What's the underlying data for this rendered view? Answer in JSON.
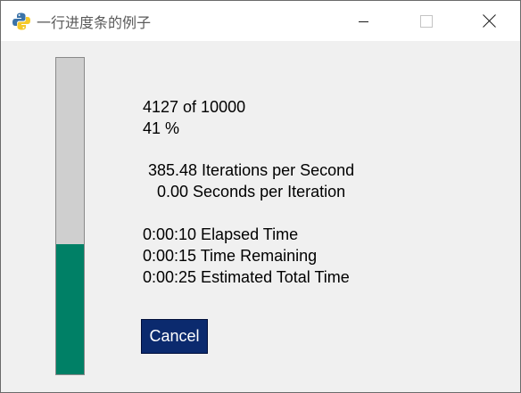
{
  "window": {
    "title": "一行进度条的例子",
    "icon": "python-icon",
    "controls": [
      "minimize-icon",
      "maximize-icon",
      "close-icon"
    ]
  },
  "progress": {
    "current": "4127",
    "total": "10000",
    "count_text": "4127 of 10000",
    "percent_text": "41 %",
    "fraction": 0.4127,
    "fill_color": "#008066",
    "track_color": "#cfcfcf"
  },
  "stats": {
    "iterations_per_second": " 385.48 Iterations per Second",
    "seconds_per_iteration": "   0.00 Seconds per Iteration",
    "elapsed": "0:00:10 Elapsed Time",
    "remaining": "0:00:15 Time Remaining",
    "estimated_total": "0:00:25 Estimated Total Time"
  },
  "buttons": {
    "cancel_label": "Cancel",
    "cancel_color": "#0b2a6e"
  }
}
